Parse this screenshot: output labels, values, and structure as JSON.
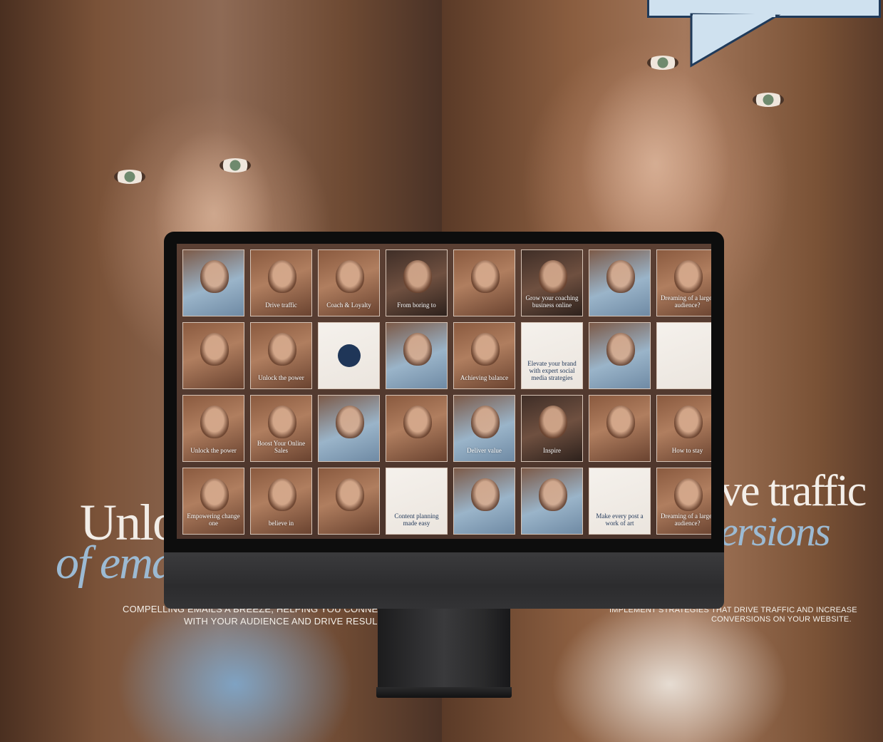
{
  "headline_left": {
    "line1": "Unlo",
    "line2": "of ema",
    "sub1": "COMPELLING EMAILS A BREEZE, HELPING YOU CONNE",
    "sub2": "WITH YOUR AUDIENCE AND DRIVE RESUL"
  },
  "headline_right": {
    "line1": "ve traffic",
    "line2": "ersions",
    "sub1": "IMPLEMENT STRATEGIES THAT DRIVE TRAFFIC AND INCREASE",
    "sub2": "CONVERSIONS ON YOUR WEBSITE."
  },
  "tiles": [
    {
      "caption": "",
      "tone": "blue"
    },
    {
      "caption": "Drive traffic",
      "tone": "warm"
    },
    {
      "caption": "Coach & Loyalty",
      "tone": "warm"
    },
    {
      "caption": "From boring to",
      "tone": "dark"
    },
    {
      "caption": "",
      "tone": "warm"
    },
    {
      "caption": "Grow your coaching business online",
      "tone": "dark"
    },
    {
      "caption": "",
      "tone": "blue"
    },
    {
      "caption": "Dreaming of a larger audience?",
      "tone": "warm"
    },
    {
      "caption": "",
      "tone": "warm"
    },
    {
      "caption": "Unlock the power",
      "tone": "warm"
    },
    {
      "caption": "",
      "tone": "light"
    },
    {
      "caption": "",
      "tone": "blue"
    },
    {
      "caption": "Achieving balance",
      "tone": "warm"
    },
    {
      "caption": "Elevate your brand with expert social media strategies",
      "tone": "light"
    },
    {
      "caption": "",
      "tone": "blue"
    },
    {
      "caption": "",
      "tone": "light"
    },
    {
      "caption": "Unlock the power",
      "tone": "warm"
    },
    {
      "caption": "Boost Your Online Sales",
      "tone": "warm"
    },
    {
      "caption": "",
      "tone": "blue"
    },
    {
      "caption": "",
      "tone": "warm"
    },
    {
      "caption": "Deliver value",
      "tone": "blue"
    },
    {
      "caption": "Inspire",
      "tone": "dark"
    },
    {
      "caption": "",
      "tone": "warm"
    },
    {
      "caption": "How to stay",
      "tone": "warm"
    },
    {
      "caption": "Empowering change one",
      "tone": "warm"
    },
    {
      "caption": "believe in",
      "tone": "warm"
    },
    {
      "caption": "",
      "tone": "warm"
    },
    {
      "caption": "Content planning made easy",
      "tone": "light"
    },
    {
      "caption": "",
      "tone": "blue"
    },
    {
      "caption": "",
      "tone": "blue"
    },
    {
      "caption": "Make every post a work of art",
      "tone": "light"
    },
    {
      "caption": "Dreaming of a larger audience?",
      "tone": "warm"
    }
  ],
  "colors": {
    "accent_blue": "#9cbad3",
    "navy": "#1f3658",
    "callout_fill": "#cfe1ef"
  }
}
